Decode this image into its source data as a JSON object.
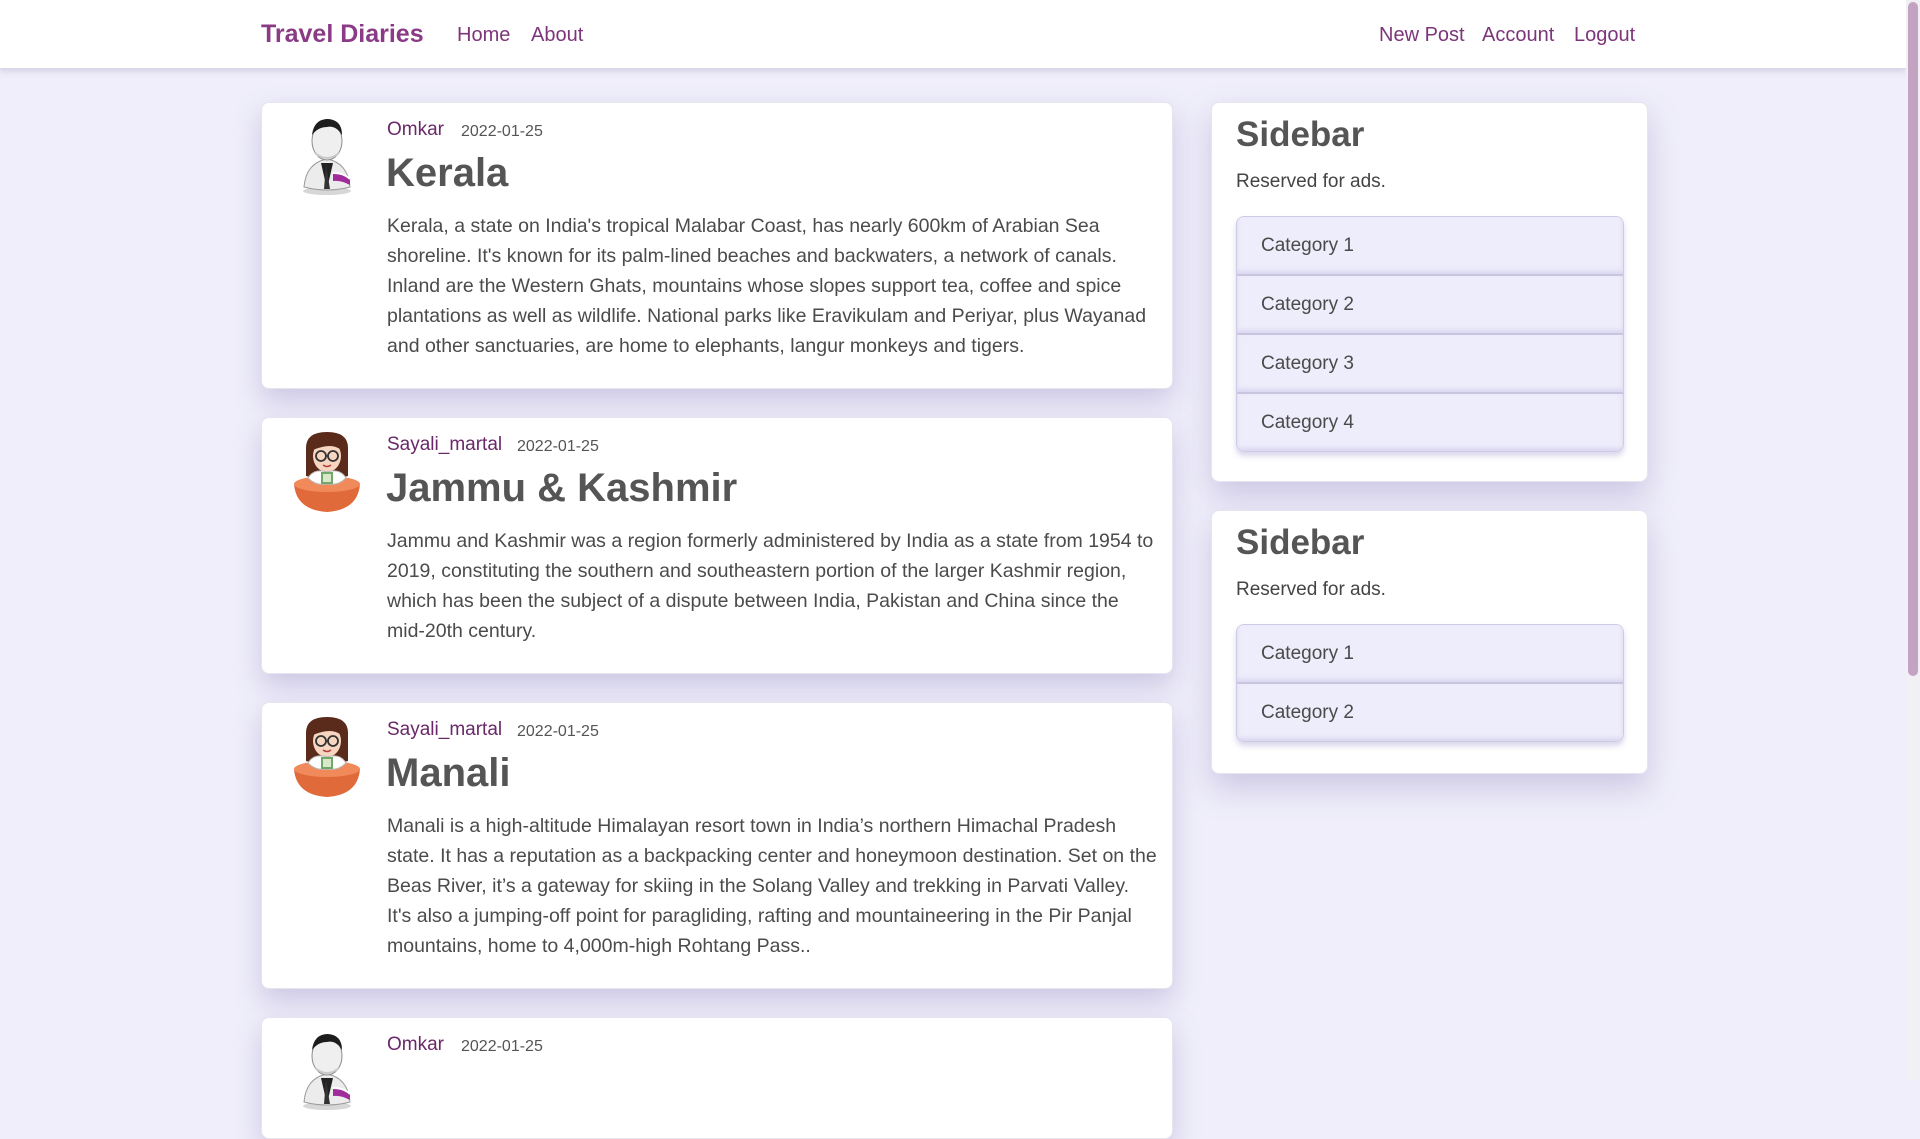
{
  "navbar": {
    "brand": "Travel Diaries",
    "left_links": [
      "Home",
      "About"
    ],
    "right_links": [
      "New Post",
      "Account",
      "Logout"
    ]
  },
  "posts": [
    {
      "author": "Omkar",
      "date": "2022-01-25",
      "title": "Kerala",
      "avatar": "man-avatar-icon",
      "body": "Kerala, a state on India's tropical Malabar Coast, has nearly 600km of Arabian Sea shoreline. It's known for its palm-lined beaches and backwaters, a network of canals. Inland are the Western Ghats, mountains whose slopes support tea, coffee and spice plantations as well as wildlife. National parks like Eravikulam and Periyar, plus Wayanad and other sanctuaries, are home to elephants, langur monkeys and tigers."
    },
    {
      "author": "Sayali_martal",
      "date": "2022-01-25",
      "title": "Jammu & Kashmir",
      "avatar": "woman-avatar-icon",
      "body": "Jammu and Kashmir was a region formerly administered by India as a state from 1954 to 2019, constituting the southern and southeastern portion of the larger Kashmir region, which has been the subject of a dispute between India, Pakistan and China since the mid-20th century."
    },
    {
      "author": "Sayali_martal",
      "date": "2022-01-25",
      "title": "Manali",
      "avatar": "woman-avatar-icon",
      "body": "Manali is a high-altitude Himalayan resort town in India’s northern Himachal Pradesh state. It has a reputation as a backpacking center and honeymoon destination. Set on the Beas River, it’s a gateway for skiing in the Solang Valley and trekking in Parvati Valley. It's also a jumping-off point for paragliding, rafting and mountaineering in the Pir Panjal mountains, home to 4,000m-high Rohtang Pass.."
    },
    {
      "author": "Omkar",
      "date": "2022-01-25",
      "title": "",
      "avatar": "man-avatar-icon",
      "body": ""
    }
  ],
  "sidebars": [
    {
      "title": "Sidebar",
      "text": "Reserved for ads.",
      "categories": [
        "Category 1",
        "Category 2",
        "Category 3",
        "Category 4"
      ]
    },
    {
      "title": "Sidebar",
      "text": "Reserved for ads.",
      "categories": [
        "Category 1",
        "Category 2"
      ]
    }
  ],
  "colors": {
    "brand": "#8b3a86",
    "link": "#7d357a",
    "author": "#6a2868",
    "page_background": "#efeefa",
    "category_background": "#eeedfb"
  }
}
